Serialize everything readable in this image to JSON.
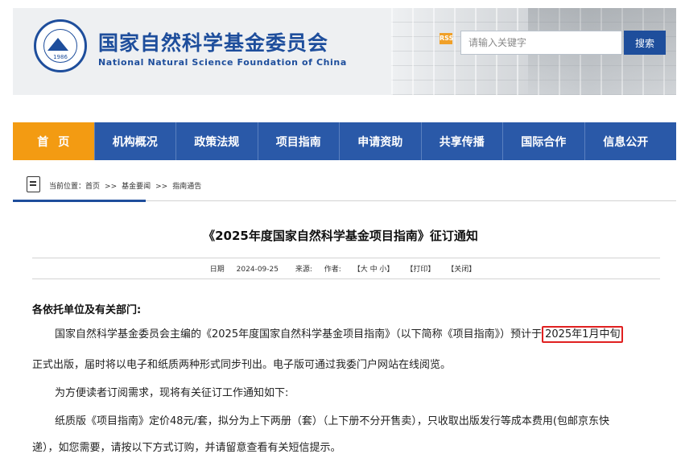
{
  "header": {
    "org_name_cn": "国家自然科学基金委员会",
    "org_name_en": "National Natural Science Foundation of China",
    "logo_year": "1986",
    "rss_label": "RSS",
    "search": {
      "placeholder": "请输入关键字",
      "button_label": "搜索"
    }
  },
  "nav": {
    "items": [
      "首页",
      "机构概况",
      "政策法规",
      "项目指南",
      "申请资助",
      "共享传播",
      "国际合作",
      "信息公开"
    ],
    "active_index": 0
  },
  "breadcrumb": {
    "prefix": "当前位置：",
    "items": [
      "首页",
      "基金要闻",
      "指南通告"
    ],
    "separator": ">>"
  },
  "article": {
    "title": "《2025年度国家自然科学基金项目指南》征订通知",
    "meta": {
      "date_label": "日期",
      "date": "2024-09-25",
      "source_label": "来源:",
      "author_label": "作者:",
      "font_size": "【大 中 小】",
      "print": "【打印】",
      "close": "【关闭】"
    },
    "salutation": "各依托单位及有关部门:",
    "p1_a": "国家自然科学基金委员会主编的《2025年度国家自然科学基金项目指南》（以下简称《项目指南》）预计于",
    "p1_highlight": "2025年1月中旬",
    "p1_b": "正式出版，届时将以电子和纸质两种形式同步刊出。电子版可通过我委门户网站在线阅览。",
    "p2": "为方便读者订阅需求，现将有关征订工作通知如下:",
    "p3_a": "纸质版《项目指南》定价48元/套，拟分为上下两册（套）（上下册不分开售卖），只收取出版发行等成本费用(包邮京东快",
    "p3_b": "递），如您需要，请按以下方式订购，并请留意查看有关短信提示。"
  },
  "colors": {
    "brand_blue": "#1e4e9c",
    "nav_blue": "#2a59a8",
    "nav_active": "#f39b12",
    "highlight_red": "#e02020"
  }
}
